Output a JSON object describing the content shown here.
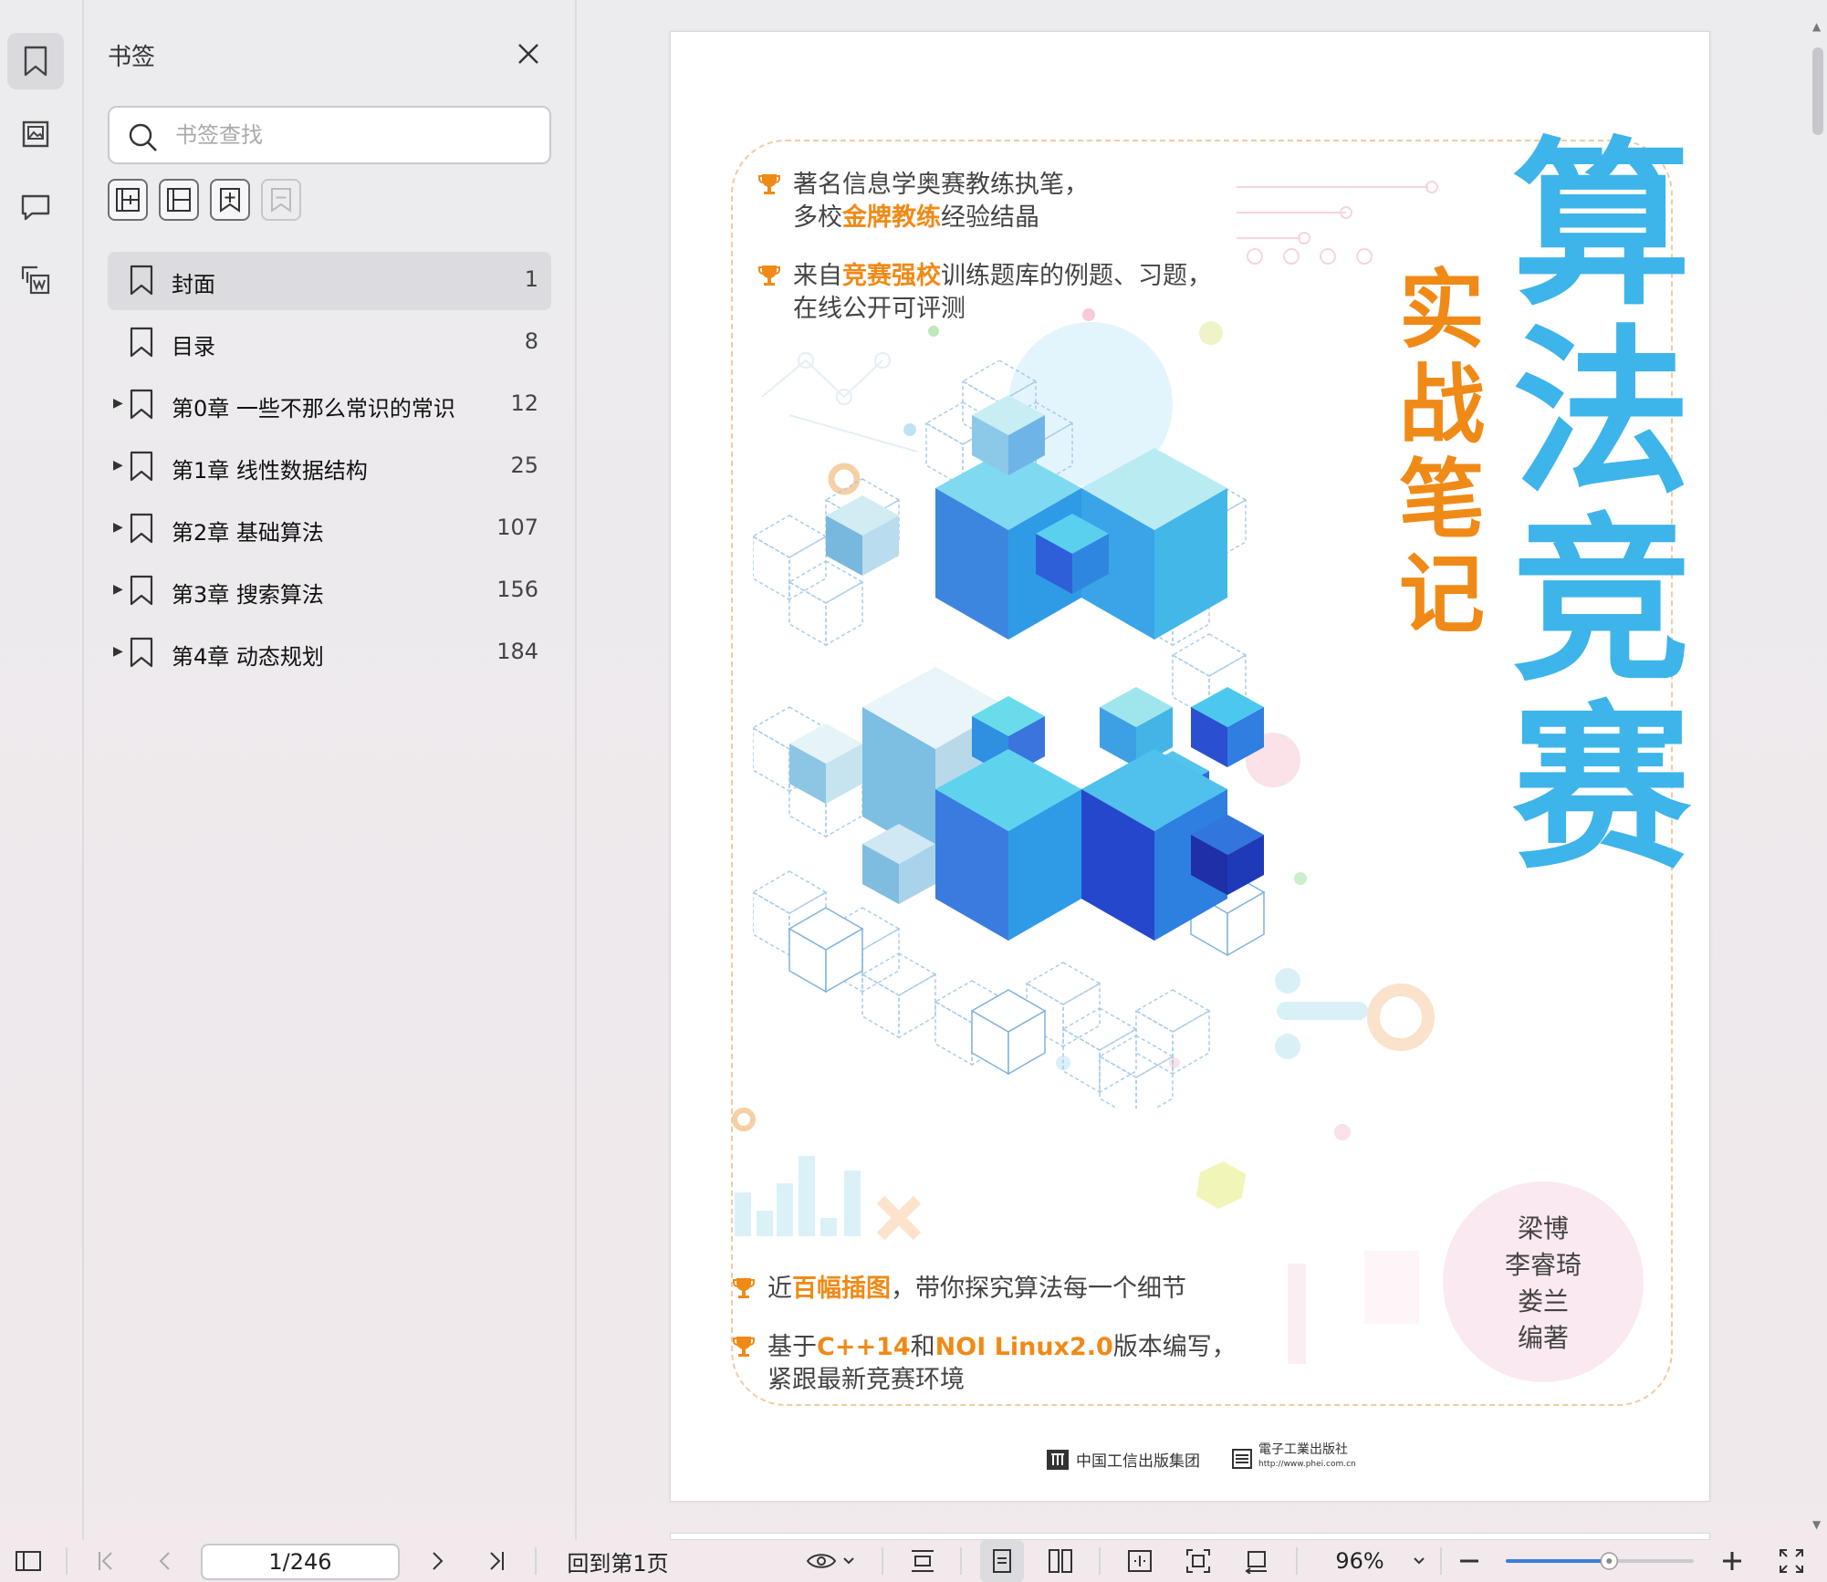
{
  "panel": {
    "title": "书签",
    "search_placeholder": "书签查找",
    "tools": [
      "add-bookmark-icon",
      "remove-bookmark-icon",
      "bookmark-add-child-icon",
      "bookmark-disabled-icon"
    ]
  },
  "rail": {
    "items": [
      "bookmark-icon",
      "thumbnail-icon",
      "comment-icon",
      "attachment-icon"
    ]
  },
  "bookmarks": [
    {
      "label": "封面",
      "page": "1",
      "expandable": false,
      "active": true
    },
    {
      "label": "目录",
      "page": "8",
      "expandable": false,
      "active": false
    },
    {
      "label": "第0章 一些不那么常识的常识",
      "page": "12",
      "expandable": true,
      "active": false
    },
    {
      "label": "第1章 线性数据结构",
      "page": "25",
      "expandable": true,
      "active": false
    },
    {
      "label": "第2章 基础算法",
      "page": "107",
      "expandable": true,
      "active": false
    },
    {
      "label": "第3章 搜索算法",
      "page": "156",
      "expandable": true,
      "active": false
    },
    {
      "label": "第4章 动态规划",
      "page": "184",
      "expandable": true,
      "active": false
    }
  ],
  "cover": {
    "title_main": [
      "算",
      "法",
      "竞",
      "赛"
    ],
    "title_sub": [
      "实",
      "战",
      "笔",
      "记"
    ],
    "bullet1_line1": "著名信息学奥赛教练执笔，",
    "bullet1_line2_pre": "多校",
    "bullet1_line2_hl": "金牌教练",
    "bullet1_line2_post": "经验结晶",
    "bullet2_line1_pre": "来自",
    "bullet2_line1_hl": "竞赛强校",
    "bullet2_line1_post": "训练题库的例题、习题，",
    "bullet2_line2": "在线公开可评测",
    "bullet3_pre": "近",
    "bullet3_hl": "百幅插图",
    "bullet3_post": "，带你探究算法每一个细节",
    "bullet4_line1_pre": "基于",
    "bullet4_line1_hl1": "C++14",
    "bullet4_line1_mid": "和",
    "bullet4_line1_hl2": "NOI Linux2.0",
    "bullet4_line1_post": "版本编写，",
    "bullet4_line2": "紧跟最新竞赛环境",
    "authors": [
      "梁博",
      "李睿琦",
      "娄兰",
      "编著"
    ],
    "publisher1": "中国工信出版集团",
    "publisher2_name": "電子工業出版社",
    "publisher2_url": "http://www.phei.com.cn",
    "colors": {
      "title": "#3db4ea",
      "accent": "#f08a17",
      "cube_dark": "#2b4fd1",
      "cube_light": "#5fd3ee"
    }
  },
  "bottombar": {
    "page_indicator": "1/246",
    "back_to_first": "回到第1页",
    "zoom": "96%",
    "zoom_fraction": 0.55
  }
}
